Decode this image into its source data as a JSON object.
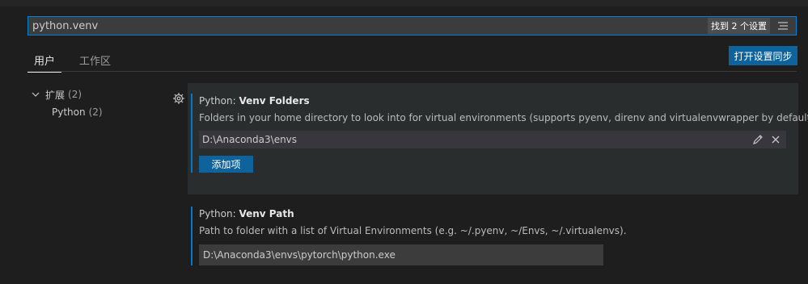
{
  "search": {
    "value": "python.venv",
    "result_count": "找到 2 个设置"
  },
  "tabs": [
    {
      "label": "用户"
    },
    {
      "label": "工作区"
    }
  ],
  "sync_button": "打开设置同步",
  "toc": {
    "group": {
      "label": "扩展",
      "count": "(2)"
    },
    "child": {
      "label": "Python",
      "count": "(2)"
    }
  },
  "settings": [
    {
      "category": "Python: ",
      "name": "Venv Folders",
      "description": "Folders in your home directory to look into for virtual environments (supports pyenv, direnv and virtualenvwrapper by default).",
      "items": [
        "D:\\Anaconda3\\envs"
      ],
      "add_button": "添加项"
    },
    {
      "category": "Python: ",
      "name": "Venv Path",
      "description": "Path to folder with a list of Virtual Environments (e.g. ~/.pyenv, ~/Envs, ~/.virtualenvs).",
      "value": "D:\\Anaconda3\\envs\\pytorch\\python.exe"
    }
  ],
  "colors": {
    "accent": "#007acc",
    "button": "#0e639c",
    "focus_border": "#007fd4"
  }
}
